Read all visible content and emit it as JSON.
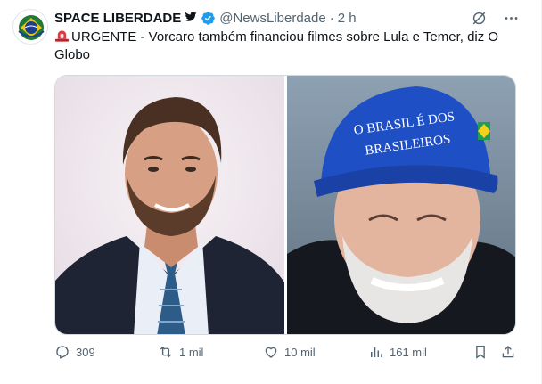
{
  "account": {
    "display_name": "SPACE LIBERDADE",
    "bird_icon": "bird-icon",
    "handle": "@NewsLiberdade",
    "separator": "·",
    "time": "2 h",
    "avatar_icon": "space-liberdade-logo"
  },
  "post": {
    "text": "URGENTE - Vorcaro também financiou filmes sobre Lula e Temer, diz O Globo",
    "emoji": "siren-icon"
  },
  "media": {
    "left_photo": "man-in-suit-photo",
    "right_photo": "man-in-blue-cap-photo",
    "cap_text": "O BRASIL É DOS BRASILEIROS"
  },
  "actions": {
    "replies": "309",
    "reposts": "1 mil",
    "likes": "10 mil",
    "views": "161 mil"
  },
  "colors": {
    "text_primary": "#0f1419",
    "text_secondary": "#536471",
    "verified_blue": "#1d9bf0",
    "border": "#cfd9de"
  }
}
